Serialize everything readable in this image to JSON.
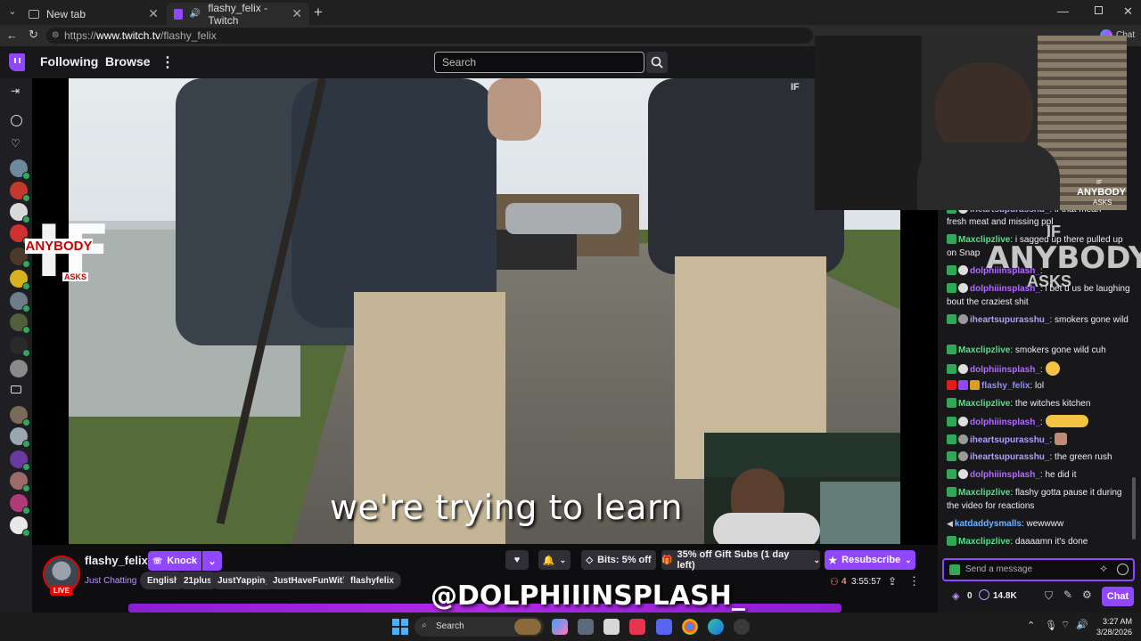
{
  "browser": {
    "tabs": [
      {
        "label": "New tab",
        "active": false
      },
      {
        "label": "flashy_felix - Twitch",
        "active": true
      }
    ],
    "url_prefix": "https://",
    "url_host": "www.twitch.tv",
    "url_path": "/flashy_felix",
    "chat_label": "Chat"
  },
  "nav": {
    "following": "Following",
    "browse": "Browse",
    "search_placeholder": "Search"
  },
  "video": {
    "caption": "we're trying to learn",
    "logo_top": "IF",
    "logo_mid": "ANYBODY",
    "logo_bottom": "ASKS",
    "cam_logo_top": "IF",
    "cam_logo_mid": "ANYBODY",
    "cam_logo_bottom": "ASKS"
  },
  "chat": {
    "overlay_logo_top": "IF",
    "overlay_logo_mid": "ANYBODY",
    "overlay_logo_bottom": "ASKS",
    "messages": [
      {
        "user": "iheartsupurasshu_",
        "color": "#b59cff",
        "text": ": if that mean"
      },
      {
        "user": "",
        "color": "#efeff1",
        "text": "fresh meat and missing ppl"
      },
      {
        "user": "Maxclipzlive",
        "color": "#57e08a",
        "text": ": i sagged up there pulled up on Snap"
      },
      {
        "user": "dolphiiinsplash_",
        "color": "#b06cff",
        "text": ":"
      },
      {
        "user": "dolphiiinsplash_",
        "color": "#b06cff",
        "text": ": i bet u us be laughing bout the craziest shit"
      },
      {
        "user": "iheartsupurasshu_",
        "color": "#b59cff",
        "text": ": smokers gone wild"
      },
      {
        "user": "Maxclipzlive",
        "color": "#57e08a",
        "text": ": smokers gone wild cuh"
      },
      {
        "user": "dolphiiinsplash_",
        "color": "#b06cff",
        "text": ":"
      },
      {
        "user": "flashy_felix",
        "color": "#8f8fff",
        "text": ": lol"
      },
      {
        "user": "Maxclipzlive",
        "color": "#57e08a",
        "text": ": the witches kitchen"
      },
      {
        "user": "dolphiiinsplash_",
        "color": "#b06cff",
        "text": ":"
      },
      {
        "user": "iheartsupurasshu_",
        "color": "#b59cff",
        "text": ":"
      },
      {
        "user": "iheartsupurasshu_",
        "color": "#b59cff",
        "text": ": the green rush"
      },
      {
        "user": "dolphiiinsplash_",
        "color": "#b06cff",
        "text": ": he did it"
      },
      {
        "user": "Maxclipzlive",
        "color": "#57e08a",
        "text": ": flashy gotta pause it during the video for reactions"
      },
      {
        "user": "katdaddysmalls",
        "color": "#6fb3ff",
        "text": ": wewwww"
      },
      {
        "user": "Maxclipzlive",
        "color": "#57e08a",
        "text": ": daaaamn it's done"
      }
    ],
    "input_placeholder": "Send a message",
    "points": "0",
    "bits": "14.8K",
    "chat_button": "Chat"
  },
  "channel": {
    "name": "flashy_felix",
    "knock": "Knock",
    "category": "Just Chatting",
    "live_badge": "LIVE",
    "tags": [
      "English",
      "21plus",
      "JustYapping",
      "JustHaveFunWithIt",
      "flashyfelix"
    ],
    "bits_offer": "Bits: 5% off",
    "gift_subs": "35% off Gift Subs (1 day left)",
    "resubscribe": "Resubscribe",
    "viewers": "4",
    "uptime": "3:55:57",
    "overlay_handle": "@DOLPHIIINSPLASH_"
  },
  "taskbar": {
    "search": "Search",
    "time": "3:27 AM",
    "date": "3/28/2026"
  },
  "colors": {
    "twitch_purple": "#9147ff",
    "live_red": "#eb0400",
    "chat_bg": "#18181b"
  }
}
